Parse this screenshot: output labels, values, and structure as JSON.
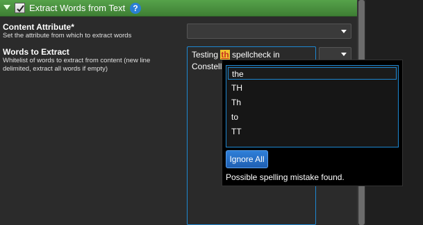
{
  "header": {
    "title": "Extract Words from Text",
    "help": "?"
  },
  "content_attribute": {
    "label": "Content Attribute*",
    "help": "Set the attribute from which to extract words",
    "value": ""
  },
  "words_to_extract": {
    "label": "Words to Extract",
    "help_line1": "Whitelist of words to extract from content (new line",
    "help_line2": "delimited, extract all words if empty)",
    "text_before": "Testing ",
    "misspelled_word": "th",
    "text_after": " spellcheck in",
    "line2": "Constell"
  },
  "spellcheck_popup": {
    "suggestions": [
      "the",
      "TH",
      "Th",
      "to",
      "TT"
    ],
    "selected_index": 0,
    "ignore_all_label": "Ignore All",
    "status": "Possible spelling mistake found."
  }
}
